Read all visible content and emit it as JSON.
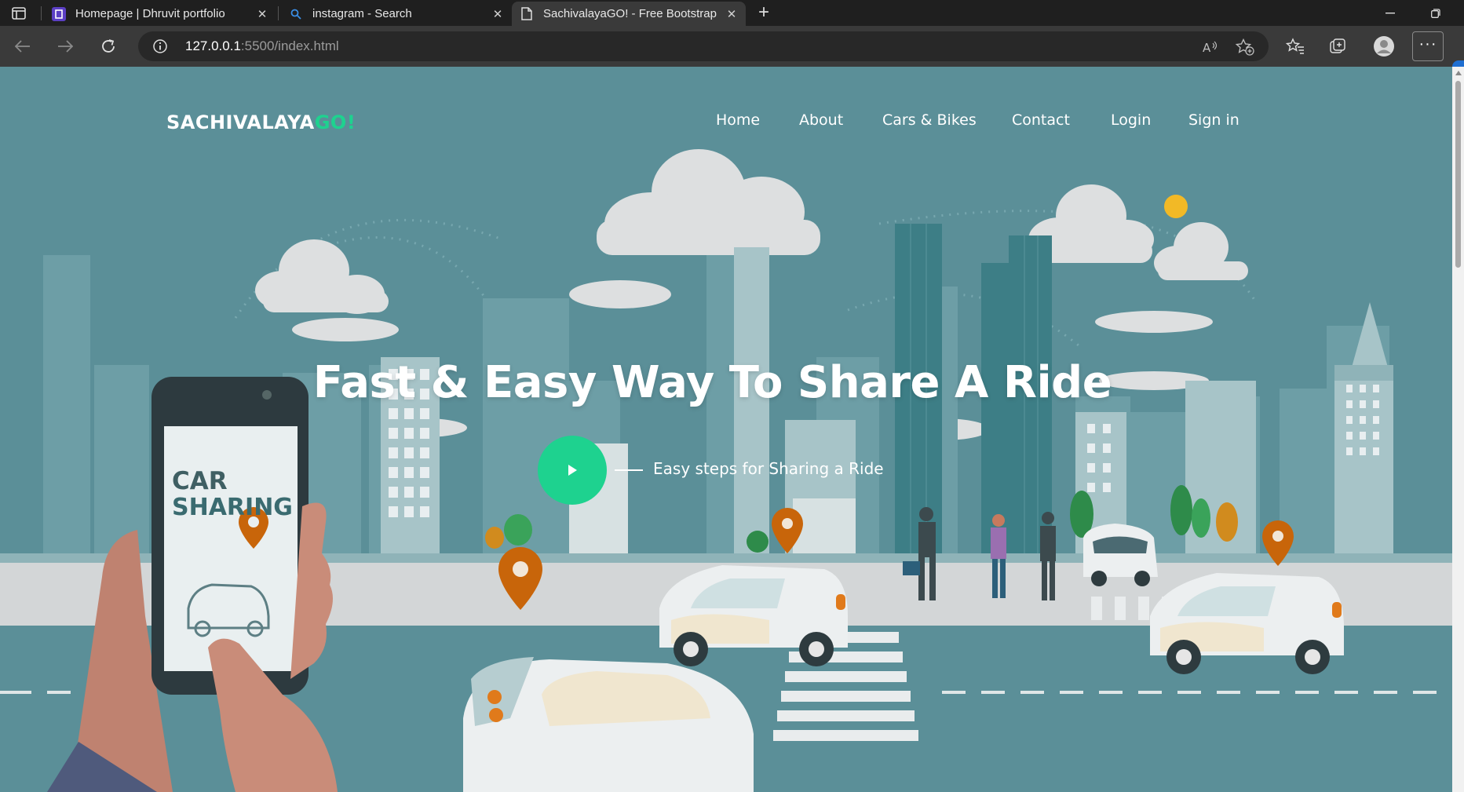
{
  "browser": {
    "tabs": [
      {
        "title": "Homepage | Dhruvit portfolio",
        "icon": "portfolio-favicon-icon",
        "active": false
      },
      {
        "title": "instagram - Search",
        "icon": "search-icon",
        "active": false
      },
      {
        "title": "SachivalayaGO! - Free Bootstrap",
        "icon": "page-icon",
        "active": true
      }
    ],
    "address_bar": {
      "url_host": "127.0.0.1",
      "url_rest": ":5500/index.html"
    },
    "icons": [
      "back-icon",
      "forward-icon",
      "refresh-icon",
      "info-icon",
      "read-aloud-icon",
      "add-favorite-icon",
      "favorites-icon",
      "collections-icon",
      "profile-icon",
      "more-icon"
    ]
  },
  "site": {
    "logo_main": "SACHIVALAYA",
    "logo_accent": "GO!",
    "nav": [
      {
        "label": "Home",
        "active": true
      },
      {
        "label": "About",
        "active": false
      },
      {
        "label": "Cars & Bikes",
        "active": false
      },
      {
        "label": "Contact",
        "active": false
      },
      {
        "label": "Login",
        "active": false
      },
      {
        "label": "Sign in",
        "active": false
      }
    ],
    "hero_title": "Fast & Easy Way To Share A Ride",
    "play_label": "Easy steps for Sharing a Ride",
    "illustration": {
      "phone_line1": "CAR",
      "phone_line2": "SHARING"
    },
    "colors": {
      "accent": "#1ed28f",
      "sky": "#5a8f97",
      "road": "#5b8f98",
      "pin": "#c8650a"
    }
  }
}
